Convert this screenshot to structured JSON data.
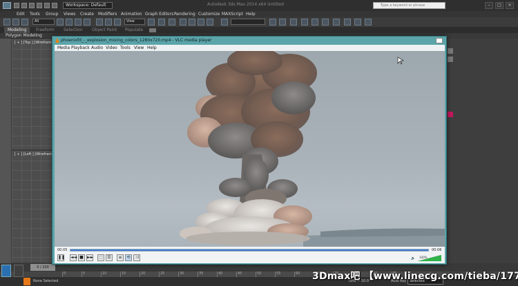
{
  "titlebar": {
    "workspace_label": "Workspace: Default",
    "app_title": "Autodesk 3ds Max 2014 x64    Untitled",
    "search_placeholder": "Type a keyword or phrase"
  },
  "menubar": {
    "items": [
      "Edit",
      "Tools",
      "Group",
      "Views",
      "Create",
      "Modifiers",
      "Animation",
      "Graph Editors",
      "Rendering",
      "Customize",
      "MAXScript",
      "Help"
    ]
  },
  "toolbar": {
    "selection_filter": "All",
    "ref_coord": "View"
  },
  "ribbon": {
    "tabs": [
      "Modeling",
      "Freeform",
      "Selection",
      "Object Paint",
      "Populate"
    ],
    "active_tab": "Modeling",
    "subpanel": "Polygon Modeling"
  },
  "viewports": {
    "top_label": "[ + ] [Top ] [Wireframe ]",
    "left_label": "[ + ] [Left ] [Wireframe ]"
  },
  "vlc": {
    "title": "phoenixfd_-_explosion_mixing_colors_1280x720.mp4 - VLC media player",
    "menu": [
      "Media",
      "Playback",
      "Audio",
      "Video",
      "Tools",
      "View",
      "Help"
    ],
    "time_elapsed": "00:05",
    "time_total": "00:06",
    "seek_progress": 1.0,
    "volume_label": "100%",
    "volume_level": 1.0
  },
  "timeline": {
    "slider_label": "0 / 100",
    "ruler_labels": [
      "0",
      "5",
      "10",
      "15",
      "20",
      "25",
      "30",
      "35",
      "40",
      "45",
      "50",
      "55",
      "60",
      "65",
      "70",
      "75",
      "80",
      "85"
    ]
  },
  "status": {
    "selection_text": "None Selected",
    "grid_text": "Grid = 10.0",
    "auto_key": "Auto Key",
    "selected_dropdown": "Selected"
  },
  "watermark": {
    "text": "3Dmax吧 【www.linecg.com/tieba/1771】"
  },
  "colors": {
    "vlc_frame": "#5ba4a9",
    "max_bg": "#444444",
    "seek_fill": "#3d7bd0",
    "volume_fill": "#2fb34a"
  }
}
